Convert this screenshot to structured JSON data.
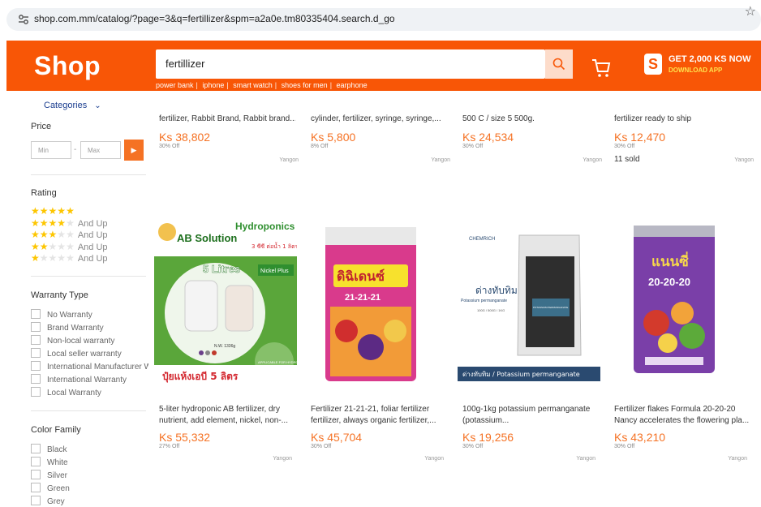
{
  "browser": {
    "url": "shop.com.mm/catalog/?page=3&q=fertillizer&spm=a2a0e.tm80335404.search.d_go"
  },
  "header": {
    "logo": "Shop",
    "search_value": "fertillizer",
    "promo_title": "GET 2,000 KS NOW",
    "promo_sub": "DOWNLOAD APP",
    "promo_badge": "S",
    "suggestions": [
      "power bank",
      "iphone",
      "smart watch",
      "shoes for men",
      "earphone"
    ]
  },
  "sidebar": {
    "categories": "Categories",
    "price_title": "Price",
    "price_min_placeholder": "Min",
    "price_max_placeholder": "Max",
    "price_dash": "-",
    "rating_title": "Rating",
    "rating_and_up": "And Up",
    "ratings": [
      5,
      4,
      3,
      2,
      1
    ],
    "warranty_title": "Warranty Type",
    "warranty_options": [
      "No Warranty",
      "Brand Warranty",
      "Non-local warranty",
      "Local seller warranty",
      "International Manufacturer W",
      "International Warranty",
      "Local Warranty"
    ],
    "color_title": "Color Family",
    "color_options": [
      "Black",
      "White",
      "Silver",
      "Green",
      "Grey"
    ]
  },
  "top_row": [
    {
      "title": "fertilizer, Rabbit Brand, Rabbit brand...",
      "price": "Ks 38,802",
      "off": "30% Off",
      "loc": "Yangon",
      "sold": ""
    },
    {
      "title": "cylinder, fertilizer, syringe, syringe,...",
      "price": "Ks 5,800",
      "off": "8% Off",
      "loc": "Yangon",
      "sold": ""
    },
    {
      "title": "500 C / size 5 500g.",
      "price": "Ks 24,534",
      "off": "30% Off",
      "loc": "Yangon",
      "sold": ""
    },
    {
      "title": "fertilizer ready to ship",
      "price": "Ks 12,470",
      "off": "30% Off",
      "loc": "Yangon",
      "sold": "11 sold"
    }
  ],
  "products": [
    {
      "title1": "5-liter hydroponic AB fertilizer, dry",
      "title2": "nutrient, add element, nickel, non-...",
      "price": "Ks 55,332",
      "off": "27% Off",
      "loc": "Yangon",
      "img": {
        "top": "Hydroponics",
        "brand": "AB Solution",
        "thai_top": "3 ซีซี ต่อน้ำ 1 ลิตร",
        "litres": "5 Litres",
        "nickel": "Nickel Plus",
        "bottom": "ปุ๋ยแห้งเอบี 5 ลิตร",
        "badge": "APPLICABLE FOR HYDROPONIC SYSTEM",
        "nw": "N.W. 1336g"
      }
    },
    {
      "title1": "Fertilizer 21-21-21, foliar fertilizer",
      "title2": "fertilizer, always organic fertilizer,...",
      "price": "Ks 45,704",
      "off": "30% Off",
      "loc": "Yangon",
      "img": {
        "label": "ดิฉิเดนซ์",
        "formula": "21-21-21"
      }
    },
    {
      "title1": "100g-1kg potassium permanganate",
      "title2": "(potassium...",
      "price": "Ks 19,256",
      "off": "30% Off",
      "loc": "Yangon",
      "img": {
        "brand": "CHEMRICH",
        "thai": "ด่างทับทิม",
        "eng": "Potassium permanganate",
        "sizes": "100G / 500G / 1KG",
        "pack": "POTASSIUM PERMANGANATE",
        "bottom": "ด่างทับทิม / Potassium permanganate"
      }
    },
    {
      "title1": "Fertilizer flakes Formula 20-20-20",
      "title2": "Nancy accelerates the flowering pla...",
      "price": "Ks 43,210",
      "off": "30% Off",
      "loc": "Yangon",
      "img": {
        "brand": "แนนซี่",
        "formula": "20-20-20"
      }
    }
  ],
  "colors": {
    "accent": "#f85606",
    "price": "#f57224",
    "star": "#fdc600"
  }
}
